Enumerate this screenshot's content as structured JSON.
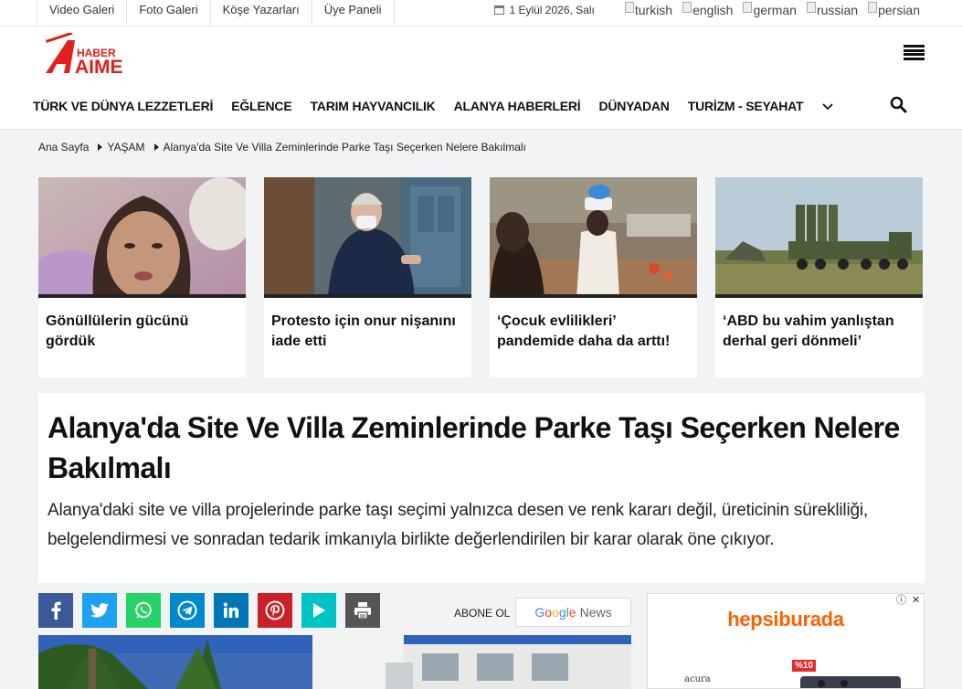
{
  "topbar": {
    "links": [
      "Video Galeri",
      "Foto Galeri",
      "Köşe Yazarları",
      "Üye Paneli"
    ],
    "date": "1 Eylül 2026, Salı",
    "languages": [
      "turkish",
      "english",
      "german",
      "russian",
      "persian"
    ]
  },
  "header": {
    "logo_text_small": "HABER",
    "logo_text_big": "AIME",
    "logo_color": "#e0201b",
    "nav": [
      "TÜRK VE DÜNYA LEZZETLERİ",
      "EĞLENCE",
      "TARIM HAYVANCILIK",
      "ALANYA HABERLERİ",
      "DÜNYADAN",
      "TURİZM - SEYAHAT"
    ]
  },
  "breadcrumb": {
    "items": [
      "Ana Sayfa",
      "YAŞAM",
      "Alanya'da Site Ve Villa Zeminlerinde Parke Taşı Seçerken Nelere Bakılmalı"
    ]
  },
  "cards": [
    {
      "title": "Gönüllülerin gücünü gördük"
    },
    {
      "title": "Protesto için onur nişanını iade etti"
    },
    {
      "title": "‘Çocuk evlilikleri’ pandemide daha da arttı!"
    },
    {
      "title": "‘ABD bu vahim yanlıştan derhal geri dönmeli’"
    }
  ],
  "article": {
    "title": "Alanya'da Site Ve Villa Zeminlerinde Parke Taşı Seçerken Nelere Bakılmalı",
    "summary": "Alanya'daki site ve villa projelerinde parke taşı seçimi yalnızca desen ve renk kararı değil, üreticinin sürekliliği, belgelendirmesi ve sonradan tedarik imkanıyla birlikte değerlendirilen bir karar olarak öne çıkıyor."
  },
  "share": {
    "buttons": [
      {
        "icon": "facebook-icon",
        "color": "#3b5998"
      },
      {
        "icon": "twitter-icon",
        "color": "#1da1f2"
      },
      {
        "icon": "whatsapp-icon",
        "color": "#25d366"
      },
      {
        "icon": "telegram-icon",
        "color": "#0088cc"
      },
      {
        "icon": "linkedin-icon",
        "color": "#0077b5"
      },
      {
        "icon": "pinterest-icon",
        "color": "#cb2027"
      },
      {
        "icon": "flipboard-icon",
        "color": "#00c4c4"
      },
      {
        "icon": "print-icon",
        "color": "#555555"
      }
    ],
    "subscribe_label": "ABONE OL",
    "gnews": {
      "g1": "G",
      "g2": "o",
      "g3": "o",
      "g4": "g",
      "g5": "l",
      "g6": "e",
      "news": "News"
    }
  },
  "ad": {
    "brand": "hepsiburada",
    "badge": "%10",
    "logo_small": "acura"
  }
}
